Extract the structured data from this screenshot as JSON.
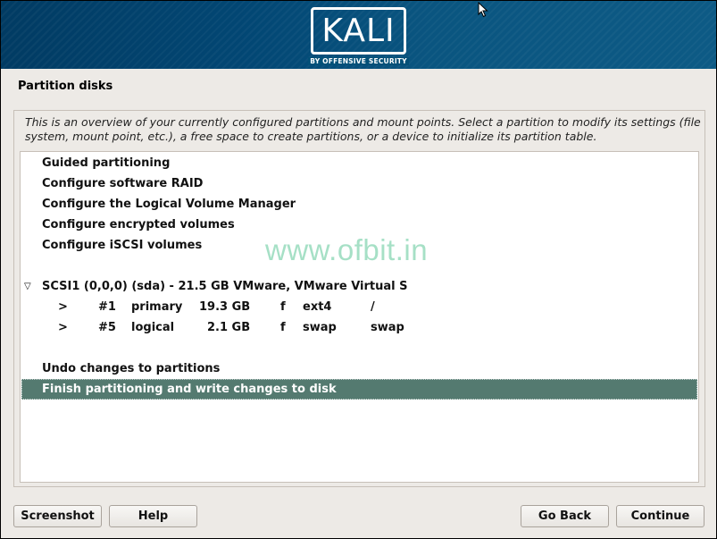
{
  "banner": {
    "logo_text": "KALI",
    "logo_subtitle": "BY OFFENSIVE SECURITY"
  },
  "page_title": "Partition disks",
  "description": "This is an overview of your currently configured partitions and mount points. Select a partition to modify its settings (file system, mount point, etc.), a free space to create partitions, or a device to initialize its partition table.",
  "list": {
    "options": [
      {
        "label": "Guided partitioning"
      },
      {
        "label": "Configure software RAID"
      },
      {
        "label": "Configure the Logical Volume Manager"
      },
      {
        "label": "Configure encrypted volumes"
      },
      {
        "label": "Configure iSCSI volumes"
      }
    ],
    "disk": {
      "expand_icon": "triangle-down-icon",
      "label": "SCSI1 (0,0,0) (sda) - 21.5 GB VMware, VMware Virtual S"
    },
    "partitions": [
      {
        "arrow": ">",
        "number": "#1",
        "type": "primary",
        "size": "19.3 GB",
        "flag": "f",
        "fs": "ext4",
        "mount": "/"
      },
      {
        "arrow": ">",
        "number": "#5",
        "type": "logical",
        "size": "2.1 GB",
        "flag": "f",
        "fs": "swap",
        "mount": "swap"
      }
    ],
    "actions": [
      {
        "label": "Undo changes to partitions",
        "selected": false
      },
      {
        "label": "Finish partitioning and write changes to disk",
        "selected": true
      }
    ]
  },
  "watermark": "www.ofbit.in",
  "buttons": {
    "screenshot": "Screenshot",
    "help": "Help",
    "go_back": "Go Back",
    "continue": "Continue"
  },
  "colors": {
    "banner": "#024774",
    "selected_row": "#547a70",
    "background": "#edeae6"
  }
}
